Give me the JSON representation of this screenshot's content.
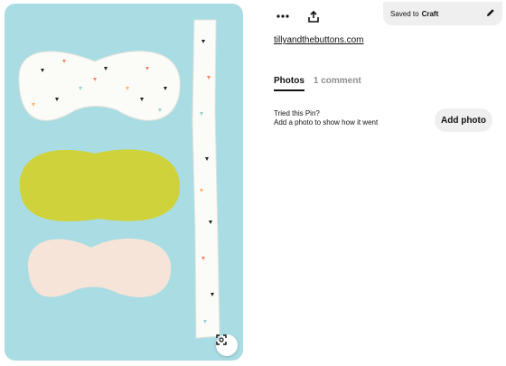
{
  "pin": {
    "image_description": "",
    "lens_icon": "visual-search-icon"
  },
  "toolbar": {
    "more_icon": "more-icon",
    "share_icon": "share-icon"
  },
  "save": {
    "prefix": "Saved to",
    "board": "Craft",
    "edit_icon": "pencil-icon"
  },
  "source": {
    "link_text": "tillyandthebuttons.com"
  },
  "tabs": [
    {
      "label": "Photos",
      "active": true
    },
    {
      "label": "1 comment",
      "active": false
    }
  ],
  "tried": {
    "title": "Tried this Pin?",
    "subtitle": "Add a photo to show how it went",
    "button_label": "Add photo"
  },
  "colors": {
    "image_bg": "#a9dde3",
    "yellow_fabric": "#cfd23a",
    "pill_bg": "#efefef"
  }
}
